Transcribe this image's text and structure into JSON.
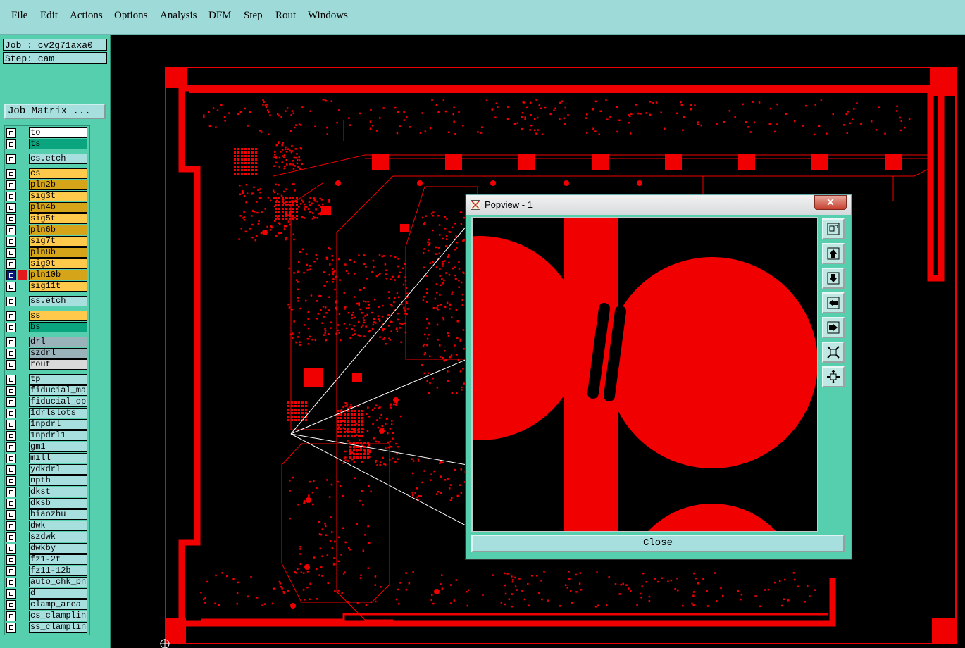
{
  "menu": [
    "File",
    "Edit",
    "Actions",
    "Options",
    "Analysis",
    "DFM",
    "Step",
    "Rout",
    "Windows"
  ],
  "job": {
    "job_line": "Job : cv2g71axa0",
    "step_line": "Step: cam",
    "matrix_button": "Job Matrix ..."
  },
  "layers": [
    {
      "name": "to",
      "color": "#ffffff",
      "red": false,
      "selected": false
    },
    {
      "name": "ts",
      "color": "#0aa57e",
      "red": false,
      "selected": false
    },
    {
      "name": "cs.etch",
      "color": "#a7dede",
      "red": false,
      "selected": false
    },
    {
      "name": "cs",
      "color": "#ffca4b",
      "red": false,
      "selected": false
    },
    {
      "name": "pln2b",
      "color": "#d6a418",
      "red": false,
      "selected": false
    },
    {
      "name": "sig3t",
      "color": "#ffca4b",
      "red": false,
      "selected": false
    },
    {
      "name": "pln4b",
      "color": "#d6a418",
      "red": false,
      "selected": false
    },
    {
      "name": "sig5t",
      "color": "#ffca4b",
      "red": false,
      "selected": false
    },
    {
      "name": "pln6b",
      "color": "#d6a418",
      "red": false,
      "selected": false
    },
    {
      "name": "sig7t",
      "color": "#ffca4b",
      "red": false,
      "selected": false
    },
    {
      "name": "pln8b",
      "color": "#d6a418",
      "red": false,
      "selected": false
    },
    {
      "name": "sig9t",
      "color": "#ffca4b",
      "red": false,
      "selected": false
    },
    {
      "name": "pln10b",
      "color": "#d6a418",
      "red": true,
      "selected": true
    },
    {
      "name": "sig11t",
      "color": "#ffca4b",
      "red": false,
      "selected": false
    },
    {
      "name": "ss.etch",
      "color": "#a7dede",
      "red": false,
      "selected": false
    },
    {
      "name": "ss",
      "color": "#ffca4b",
      "red": false,
      "selected": false
    },
    {
      "name": "bs",
      "color": "#0aa57e",
      "red": false,
      "selected": false
    },
    {
      "name": "drl",
      "color": "#9ab2ba",
      "red": false,
      "selected": false
    },
    {
      "name": "szdrl",
      "color": "#9ab2ba",
      "red": false,
      "selected": false
    },
    {
      "name": "rout",
      "color": "#d9d9d9",
      "red": false,
      "selected": false
    },
    {
      "name": "tp",
      "color": "#a7dede",
      "red": false,
      "selected": false
    },
    {
      "name": "fiducial_mar",
      "color": "#a7dede",
      "red": false,
      "selected": false
    },
    {
      "name": "fiducial_ope",
      "color": "#a7dede",
      "red": false,
      "selected": false
    },
    {
      "name": "1drlslots",
      "color": "#a7dede",
      "red": false,
      "selected": false
    },
    {
      "name": "1npdrl",
      "color": "#a7dede",
      "red": false,
      "selected": false
    },
    {
      "name": "1npdrl1",
      "color": "#a7dede",
      "red": false,
      "selected": false
    },
    {
      "name": "gm1",
      "color": "#a7dede",
      "red": false,
      "selected": false
    },
    {
      "name": "mill",
      "color": "#a7dede",
      "red": false,
      "selected": false
    },
    {
      "name": "ydkdrl",
      "color": "#a7dede",
      "red": false,
      "selected": false
    },
    {
      "name": "npth",
      "color": "#a7dede",
      "red": false,
      "selected": false
    },
    {
      "name": "dkst",
      "color": "#a7dede",
      "red": false,
      "selected": false
    },
    {
      "name": "dksb",
      "color": "#a7dede",
      "red": false,
      "selected": false
    },
    {
      "name": "biaozhu",
      "color": "#a7dede",
      "red": false,
      "selected": false
    },
    {
      "name": "dwk",
      "color": "#a7dede",
      "red": false,
      "selected": false
    },
    {
      "name": "szdwk",
      "color": "#a7dede",
      "red": false,
      "selected": false
    },
    {
      "name": "dwkby",
      "color": "#a7dede",
      "red": false,
      "selected": false
    },
    {
      "name": "fz1-2t",
      "color": "#a7dede",
      "red": false,
      "selected": false
    },
    {
      "name": "fz11-12b",
      "color": "#a7dede",
      "red": false,
      "selected": false
    },
    {
      "name": "auto_chk_pnl",
      "color": "#a7dede",
      "red": false,
      "selected": false
    },
    {
      "name": "d",
      "color": "#a7dede",
      "red": false,
      "selected": false
    },
    {
      "name": "clamp_area",
      "color": "#a7dede",
      "red": false,
      "selected": false
    },
    {
      "name": "cs_clampline",
      "color": "#a7dede",
      "red": false,
      "selected": false
    },
    {
      "name": "ss_clampline",
      "color": "#a7dede",
      "red": false,
      "selected": false
    }
  ],
  "popview": {
    "title": "Popview - 1",
    "close_label": "Close",
    "tools": [
      "zoom-fit-icon",
      "pan-up-icon",
      "pan-down-icon",
      "pan-left-icon",
      "pan-right-icon",
      "zoom-out-icon",
      "zoom-in-icon"
    ]
  },
  "colors": {
    "copper": "#f00000",
    "menu_bg": "#9ddad8",
    "panel_bg": "#56cfae"
  }
}
